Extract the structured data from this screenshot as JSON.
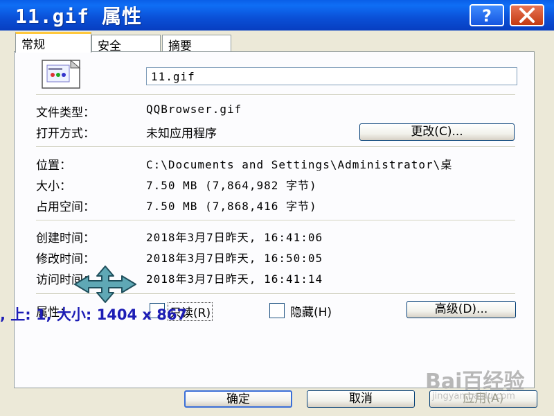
{
  "window": {
    "title": "11.gif 属性",
    "help_label": "?",
    "close_label": "✕"
  },
  "tabs": [
    {
      "label": "常规",
      "active": true
    },
    {
      "label": "安全",
      "active": false
    },
    {
      "label": "摘要",
      "active": false
    }
  ],
  "file": {
    "icon": "gif-file-icon",
    "name": "11.gif"
  },
  "type_section": {
    "type_label": "文件类型：",
    "type_value": "QQBrowser.gif",
    "opens_label": "打开方式：",
    "opens_value": "未知应用程序",
    "change_button": "更改(C)..."
  },
  "location_section": {
    "location_label": "位置：",
    "location_value": "C:\\Documents and Settings\\Administrator\\桌",
    "size_label": "大小：",
    "size_value": "7.50 MB (7,864,982 字节)",
    "disk_label": "占用空间：",
    "disk_value": "7.50 MB (7,868,416 字节)"
  },
  "time_section": {
    "created_label": "创建时间：",
    "created_value": "2018年3月7日昨天, 16:41:06",
    "modified_label": "修改时间：",
    "modified_value": "2018年3月7日昨天, 16:50:05",
    "accessed_label": "访问时间：",
    "accessed_value": "2018年3月7日昨天, 16:41:14"
  },
  "attributes": {
    "label": "属性：",
    "readonly_label": "只读(R)",
    "hidden_label": "隐藏(H)",
    "advanced_button": "高级(D)..."
  },
  "footer": {
    "ok": "确定",
    "cancel": "取消",
    "apply": "应用(A)"
  },
  "overlay_text": ", 上: 1, 大小: 1404 x 867",
  "watermark": {
    "logo": "Bai百经验",
    "url": "jingyan.baidu.com"
  },
  "colors": {
    "titlebar": "#0A4FD6",
    "tab_highlight": "#FFC83C",
    "overlay_text": "#1D1DB5",
    "cursor": "#5FA8B5"
  }
}
